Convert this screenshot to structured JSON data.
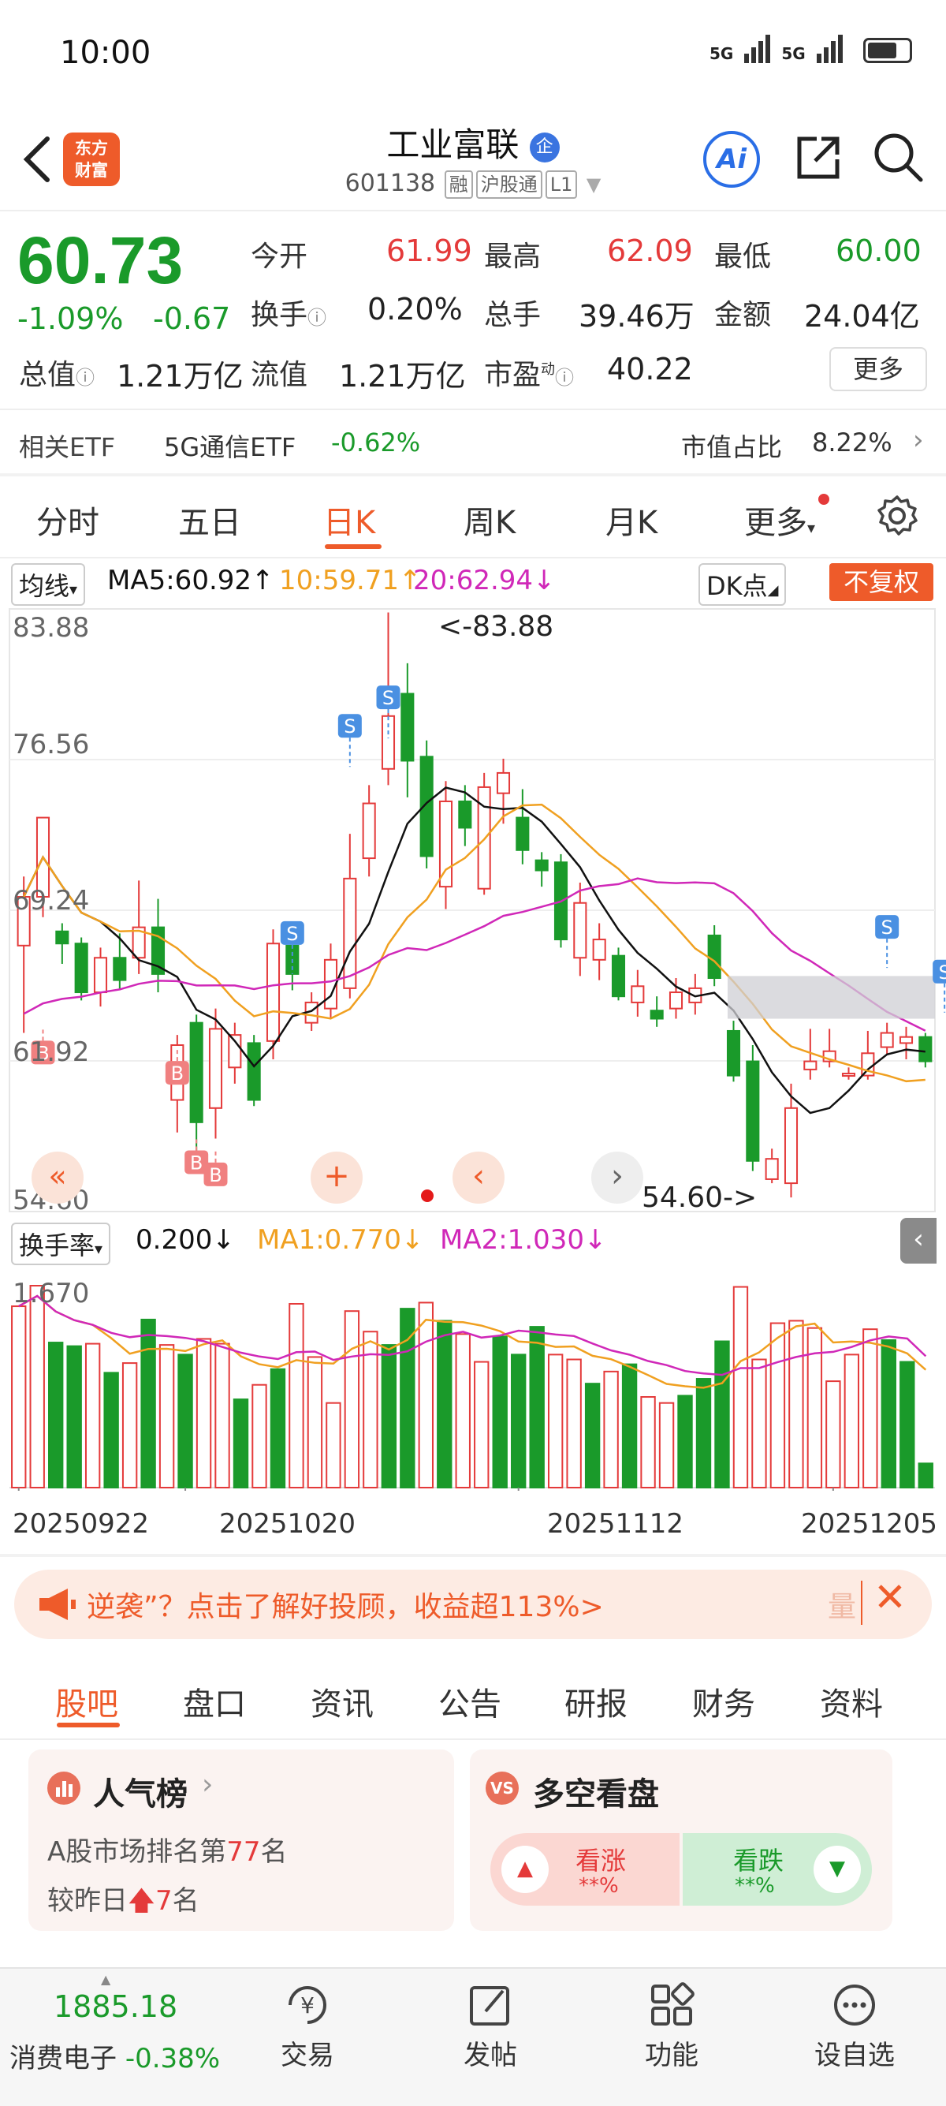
{
  "status_bar": {
    "time": "10:00",
    "signal1": "5G",
    "signal2": "5G"
  },
  "header": {
    "logo_line1": "东方",
    "logo_line2": "财富",
    "title": "工业富联",
    "enterprise_badge": "企",
    "code": "601138",
    "tag_rong": "融",
    "tag_hgt": "沪股通",
    "tag_level": "L1",
    "ai_label": "Ai"
  },
  "quote": {
    "price": "60.73",
    "change_pct": "-1.09%",
    "change": "-0.67",
    "open_label": "今开",
    "open": "61.99",
    "high_label": "最高",
    "high": "62.09",
    "low_label": "最低",
    "low": "60.00",
    "turnover_label": "换手",
    "turnover": "0.20%",
    "volume_label": "总手",
    "volume": "39.46万",
    "amount_label": "金额",
    "amount": "24.04亿",
    "mktcap_label": "总值",
    "mktcap": "1.21万亿",
    "float_label": "流值",
    "float_cap": "1.21万亿",
    "pe_label": "市盈",
    "pe_sup": "动",
    "pe": "40.22",
    "more_button": "更多"
  },
  "etf": {
    "label": "相关ETF",
    "name": "5G通信ETF",
    "change": "-0.62%",
    "ratio_label": "市值占比",
    "ratio": "8.22%"
  },
  "period_tabs": [
    "分时",
    "五日",
    "日K",
    "周K",
    "月K",
    "更多"
  ],
  "active_period_tab": "日K",
  "chart": {
    "indicator_select": "均线",
    "ma5": "MA5:60.92↑",
    "ma10": "10:59.71↑",
    "ma20": "20:62.94↓",
    "dk_button": "DK点",
    "fuquan_button": "不复权",
    "y_labels": [
      "83.88",
      "76.56",
      "69.24",
      "61.92",
      "54.60"
    ],
    "max_annotation": "<-83.88",
    "min_annotation": "54.60->",
    "vol_indicator_select": "换手率",
    "vol_value": "0.200↓",
    "vol_ma1": "MA1:0.770↓",
    "vol_ma2": "MA2:1.030↓",
    "vol_max_label": "1.670",
    "dates": [
      "20250922",
      "20251020",
      "20251112",
      "20251205"
    ],
    "marker_buy": "B",
    "marker_sell": "S",
    "colors": {
      "up": "#e43a3a",
      "down": "#1a9a2a",
      "ma5": "#111111",
      "ma10": "#f0a020",
      "ma20": "#d028b8"
    }
  },
  "chart_data": {
    "type": "candlestick",
    "ylim": [
      54.6,
      83.88
    ],
    "candles": [
      [
        67.5,
        69.9,
        63.2,
        70.9
      ],
      [
        69.9,
        73.8,
        68.9,
        73.8
      ],
      [
        68.2,
        67.6,
        66.6,
        68.6
      ],
      [
        67.6,
        65.2,
        64.8,
        67.9
      ],
      [
        65.2,
        66.9,
        64.5,
        67.4
      ],
      [
        66.9,
        65.8,
        65.3,
        68.1
      ],
      [
        66.9,
        68.4,
        66.1,
        70.7
      ],
      [
        68.4,
        66.1,
        65.2,
        69.8
      ],
      [
        59.9,
        62.6,
        58.3,
        63.1
      ],
      [
        63.7,
        58.8,
        56.9,
        64.1
      ],
      [
        59.5,
        63.4,
        58.0,
        64.4
      ],
      [
        61.5,
        63.1,
        60.7,
        63.7
      ],
      [
        62.7,
        59.9,
        59.6,
        63.1
      ],
      [
        62.8,
        67.6,
        61.9,
        68.3
      ],
      [
        67.5,
        66.1,
        65.3,
        67.5
      ],
      [
        63.7,
        64.7,
        63.3,
        65.2
      ],
      [
        64.4,
        66.8,
        63.9,
        67.6
      ],
      [
        65.4,
        70.8,
        64.9,
        73.0
      ],
      [
        71.8,
        74.5,
        70.9,
        75.4
      ],
      [
        76.2,
        78.8,
        75.4,
        83.9
      ],
      [
        79.9,
        76.6,
        74.8,
        81.4
      ],
      [
        76.8,
        71.9,
        71.3,
        77.6
      ],
      [
        70.4,
        74.6,
        69.3,
        75.6
      ],
      [
        74.6,
        73.3,
        72.4,
        75.4
      ],
      [
        70.3,
        75.3,
        70.0,
        76.0
      ],
      [
        75.0,
        76.0,
        73.5,
        76.7
      ],
      [
        73.8,
        72.2,
        71.5,
        75.2
      ],
      [
        71.7,
        71.2,
        70.4,
        72.1
      ],
      [
        71.6,
        67.8,
        67.4,
        72.0
      ],
      [
        66.9,
        69.6,
        66.0,
        70.6
      ],
      [
        66.8,
        67.8,
        65.8,
        68.6
      ],
      [
        67.0,
        65.0,
        64.8,
        67.4
      ],
      [
        64.7,
        65.5,
        64.0,
        66.3
      ],
      [
        64.3,
        63.9,
        63.5,
        65.0
      ],
      [
        64.4,
        65.2,
        63.9,
        65.9
      ],
      [
        64.7,
        65.4,
        64.1,
        66.1
      ],
      [
        68.0,
        65.9,
        65.5,
        68.5
      ],
      [
        63.3,
        61.1,
        60.8,
        63.8
      ],
      [
        61.8,
        56.9,
        56.4,
        62.6
      ],
      [
        56.0,
        57.0,
        55.8,
        57.5
      ],
      [
        55.8,
        59.5,
        55.1,
        60.7
      ],
      [
        61.4,
        61.8,
        60.9,
        63.4
      ],
      [
        61.8,
        62.3,
        61.5,
        63.4
      ],
      [
        61.2,
        61.2,
        60.9,
        61.5
      ],
      [
        61.1,
        62.2,
        60.9,
        63.3
      ],
      [
        62.5,
        63.2,
        62.1,
        63.7
      ],
      [
        62.7,
        63.0,
        61.9,
        63.5
      ],
      [
        63.0,
        61.8,
        61.5,
        63.2
      ]
    ],
    "turnover": [
      1.5,
      1.67,
      1.2,
      1.17,
      1.19,
      0.95,
      1.03,
      1.39,
      1.18,
      1.1,
      1.23,
      1.19,
      0.73,
      0.85,
      0.98,
      1.52,
      1.08,
      0.7,
      1.46,
      1.29,
      1.18,
      1.48,
      1.53,
      1.38,
      1.27,
      1.04,
      1.25,
      1.1,
      1.33,
      1.1,
      1.06,
      0.86,
      0.96,
      1.02,
      0.75,
      0.7,
      0.76,
      0.9,
      1.21,
      1.66,
      1.06,
      1.36,
      1.38,
      1.32,
      0.88,
      1.1,
      1.31,
      1.22,
      1.04,
      0.2
    ],
    "ma5": [],
    "ma10": [],
    "ma20": []
  },
  "ad_bar": {
    "text": "逆袭”？点击了解好投顾，收益超113%>",
    "right_text": "量"
  },
  "content_tabs": [
    "股吧",
    "盘口",
    "资讯",
    "公告",
    "研报",
    "财务",
    "资料"
  ],
  "active_content_tab": "股吧",
  "popularity": {
    "title": "人气榜",
    "line1_prefix": "A股市场排名第",
    "rank": "77",
    "line1_suffix": "名",
    "line2_prefix": "较昨日",
    "change": "7",
    "line2_suffix": "名"
  },
  "long_short": {
    "title": "多空看盘",
    "up_label": "看涨",
    "up_pct": "**%",
    "down_label": "看跌",
    "down_pct": "**%"
  },
  "bottom_bar": {
    "index_value": "1885.18",
    "index_name": "消费电子",
    "index_change": "-0.38%",
    "items": [
      "交易",
      "发帖",
      "功能",
      "设自选"
    ]
  }
}
